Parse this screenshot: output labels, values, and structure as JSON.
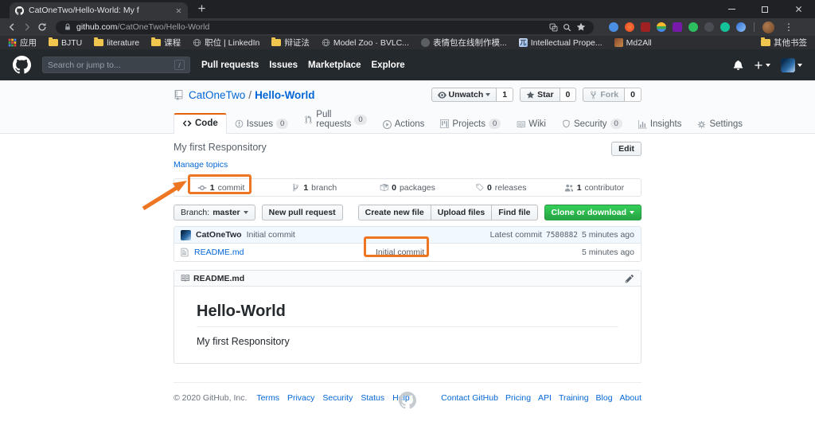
{
  "colors": {
    "annotation": "#ee7623",
    "clone_green": "#28a745",
    "tab_accent": "#e36209",
    "link_blue": "#0366d6"
  },
  "browser": {
    "tab_title": "CatOneTwo/Hello-World: My f",
    "url": {
      "host": "github.com",
      "path": "/CatOneTwo/Hello-World"
    },
    "bookmarks": [
      "应用",
      "BJTU",
      "literature",
      "课程",
      "职位 | LinkedIn",
      "辩证法",
      "Model Zoo · BVLC...",
      "表情包在线制作模...",
      "Intellectual Prope...",
      "Md2All"
    ],
    "other_bookmarks": "其他书签",
    "icons": [
      "translate-icon",
      "find-icon",
      "bookmark-star-icon",
      "extension-icons",
      "profile-avatar",
      "menu-kebab"
    ]
  },
  "gh": {
    "search_placeholder": "Search or jump to...",
    "search_key": "/",
    "nav": [
      "Pull requests",
      "Issues",
      "Marketplace",
      "Explore"
    ],
    "repo": {
      "owner": "CatOneTwo",
      "sep": "/",
      "name": "Hello-World"
    },
    "social": {
      "watch": "Unwatch",
      "watch_count": "1",
      "star": "Star",
      "star_count": "0",
      "fork": "Fork",
      "fork_count": "0"
    },
    "tabs": [
      {
        "label": "Code",
        "count": ""
      },
      {
        "label": "Issues",
        "count": "0"
      },
      {
        "label": "Pull requests",
        "count": "0"
      },
      {
        "label": "Actions",
        "count": ""
      },
      {
        "label": "Projects",
        "count": "0"
      },
      {
        "label": "Wiki",
        "count": ""
      },
      {
        "label": "Security",
        "count": "0"
      },
      {
        "label": "Insights",
        "count": ""
      },
      {
        "label": "Settings",
        "count": ""
      }
    ],
    "description": "My first Responsitory",
    "edit": "Edit",
    "manage_topics": "Manage topics",
    "stats": [
      {
        "value": "1",
        "label": "commit"
      },
      {
        "value": "1",
        "label": "branch"
      },
      {
        "value": "0",
        "label": "packages"
      },
      {
        "value": "0",
        "label": "releases"
      },
      {
        "value": "1",
        "label": "contributor"
      }
    ],
    "branch": {
      "prefix": "Branch:",
      "name": "master"
    },
    "new_pr": "New pull request",
    "create_file": "Create new file",
    "upload": "Upload files",
    "find": "Find file",
    "clone": "Clone or download",
    "commit": {
      "author": "CatOneTwo",
      "message": "Initial commit",
      "latest": "Latest commit",
      "hash": "7580882",
      "time": "5 minutes ago"
    },
    "file": {
      "name": "README.md",
      "message": "Initial commit",
      "time": "5 minutes ago"
    },
    "readme": {
      "filename": "README.md",
      "title": "Hello-World",
      "body": "My first Responsitory"
    },
    "footer": {
      "copyright": "© 2020 GitHub, Inc.",
      "left": [
        "Terms",
        "Privacy",
        "Security",
        "Status",
        "Help"
      ],
      "right": [
        "Contact GitHub",
        "Pricing",
        "API",
        "Training",
        "Blog",
        "About"
      ]
    }
  }
}
